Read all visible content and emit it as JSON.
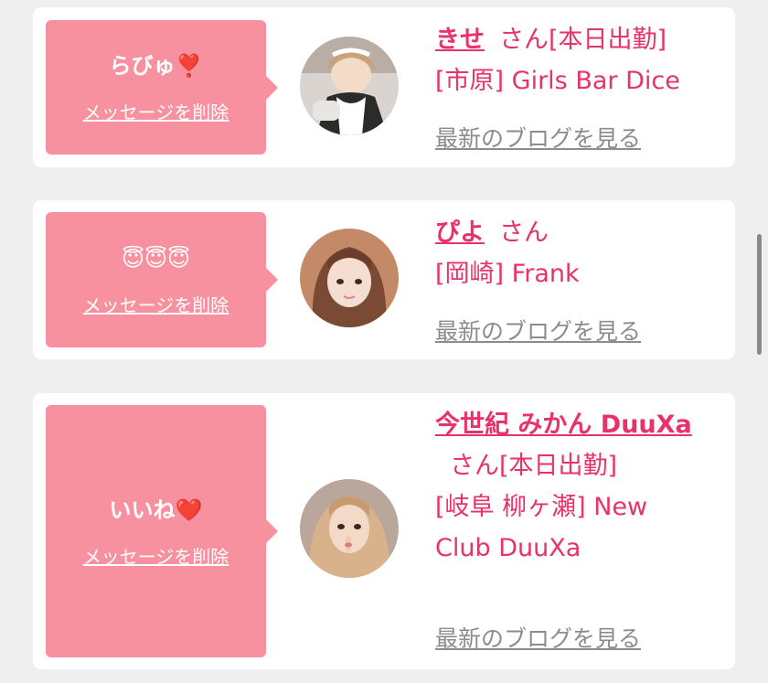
{
  "cards": [
    {
      "message": "らびゅ❣️",
      "delete_label": "メッセージを削除",
      "name": "きせ",
      "suffix": "さん[本日出勤]",
      "shop": "[市原] Girls Bar Dice",
      "blog_label": "最新のブログを見る"
    },
    {
      "message": "😇😇😇",
      "delete_label": "メッセージを削除",
      "name": "ぴよ",
      "suffix": "さん",
      "shop": "[岡崎] Frank",
      "blog_label": "最新のブログを見る"
    },
    {
      "message": "いいね❤️",
      "delete_label": "メッセージを削除",
      "name": "今世紀 みかん DuuXa",
      "suffix": "さん[本日出勤]",
      "shop": "[岐阜 柳ヶ瀬] New Club DuuXa",
      "blog_label": "最新のブログを見る"
    }
  ],
  "colors": {
    "accent": "#e8326a",
    "bubble": "#f7919f",
    "link_gray": "#8c8c8c",
    "background": "#efefef"
  }
}
